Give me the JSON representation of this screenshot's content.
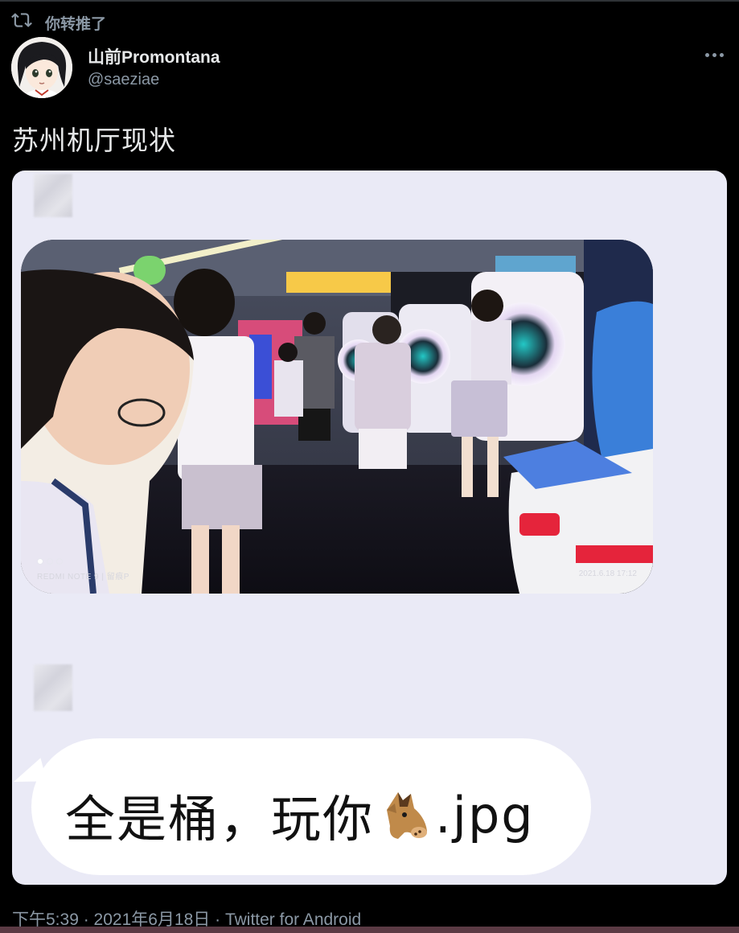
{
  "retweet": {
    "label": "你转推了",
    "icon": "retweet-icon"
  },
  "author": {
    "display_name": "山前Promontana",
    "handle": "@saeziae",
    "avatar_icon": "anime-girl-avatar"
  },
  "tweet": {
    "text": "苏州机厅现状",
    "timestamp": "下午5:39 · 2021年6月18日 · Twitter for Android"
  },
  "media": {
    "photo_watermark": "REDMI NOTE 9 | 留痕P",
    "photo_date": "2021.6.18 17:12",
    "chat_text_before": "全是桶，玩你",
    "chat_text_after": ".jpg",
    "emoji_icon": "horse-face-icon"
  },
  "colors": {
    "background": "#000000",
    "text_primary": "#e7e9ea",
    "text_secondary": "#8b98a5",
    "chat_background": "#eaeaf6",
    "bubble": "#ffffff"
  }
}
